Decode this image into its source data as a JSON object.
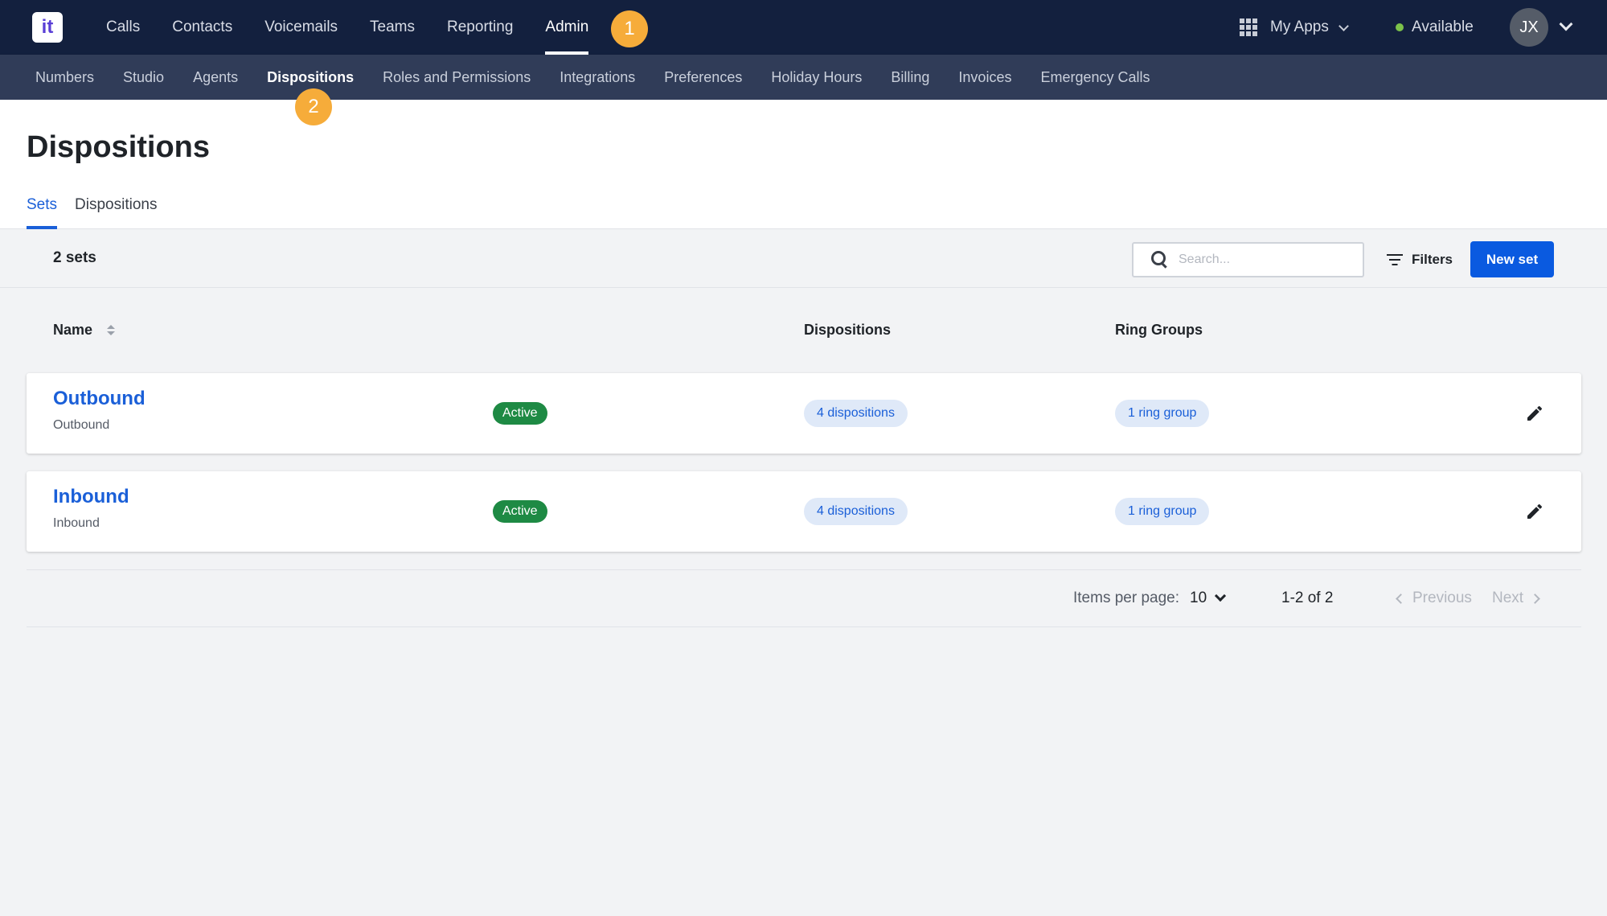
{
  "app": {
    "logo_text": "it"
  },
  "topnav": {
    "items": [
      {
        "label": "Calls"
      },
      {
        "label": "Contacts"
      },
      {
        "label": "Voicemails"
      },
      {
        "label": "Teams"
      },
      {
        "label": "Reporting"
      },
      {
        "label": "Admin",
        "active": true
      }
    ],
    "my_apps_label": "My Apps",
    "status_label": "Available",
    "status_color": "#7cc24a",
    "avatar_initials": "JX"
  },
  "subnav": {
    "items": [
      {
        "label": "Numbers"
      },
      {
        "label": "Studio"
      },
      {
        "label": "Agents"
      },
      {
        "label": "Dispositions",
        "active": true
      },
      {
        "label": "Roles and Permissions"
      },
      {
        "label": "Integrations"
      },
      {
        "label": "Preferences"
      },
      {
        "label": "Holiday Hours"
      },
      {
        "label": "Billing"
      },
      {
        "label": "Invoices"
      },
      {
        "label": "Emergency Calls"
      }
    ]
  },
  "step_badges": [
    "1",
    "2"
  ],
  "page": {
    "title": "Dispositions",
    "tabs": [
      {
        "label": "Sets",
        "active": true
      },
      {
        "label": "Dispositions"
      }
    ]
  },
  "toolbar": {
    "count_label": "2 sets",
    "search_placeholder": "Search...",
    "filters_label": "Filters",
    "new_button_label": "New set"
  },
  "table": {
    "headers": {
      "name": "Name",
      "dispositions": "Dispositions",
      "ring_groups": "Ring Groups"
    },
    "rows": [
      {
        "name": "Outbound",
        "subtitle": "Outbound",
        "status": "Active",
        "dispositions": "4 dispositions",
        "ring_groups": "1 ring group"
      },
      {
        "name": "Inbound",
        "subtitle": "Inbound",
        "status": "Active",
        "dispositions": "4 dispositions",
        "ring_groups": "1 ring group"
      }
    ]
  },
  "pagination": {
    "items_per_page_label": "Items per page:",
    "items_per_page_value": "10",
    "range_label": "1-2 of 2",
    "previous_label": "Previous",
    "next_label": "Next"
  },
  "colors": {
    "topbar": "#13203e",
    "subbar": "#303c58",
    "accent": "#1a5fd8",
    "primary_button": "#0a5ae0",
    "active_pill": "#1e8a44",
    "step_badge": "#f6ac3a"
  }
}
